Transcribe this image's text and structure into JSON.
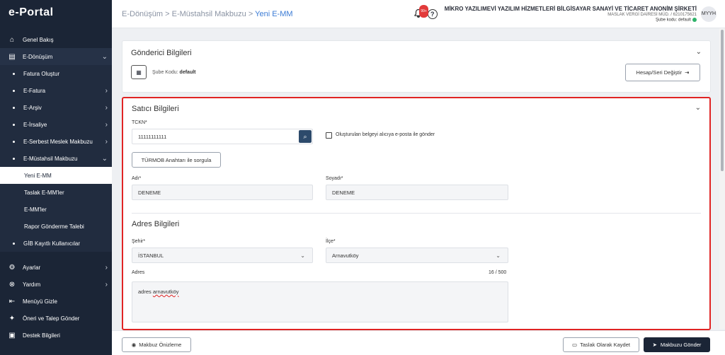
{
  "app": {
    "logo": "e-Portal"
  },
  "sidebar": {
    "items": [
      {
        "label": "Genel Bakış",
        "icon": "home-icon",
        "glyph": "⌂"
      },
      {
        "label": "E-Dönüşüm",
        "icon": "document-icon",
        "glyph": "▤",
        "chevron": "⌄"
      },
      {
        "label": "Fatura Oluştur"
      },
      {
        "label": "E-Fatura",
        "chevron": "›"
      },
      {
        "label": "E-Arşiv",
        "chevron": "›"
      },
      {
        "label": "E-İrsaliye",
        "chevron": "›"
      },
      {
        "label": "E-Serbest Meslek Makbuzu",
        "chevron": "›"
      },
      {
        "label": "E-Müstahsil Makbuzu",
        "chevron": "⌄"
      },
      {
        "label": "Yeni E-MM"
      },
      {
        "label": "Taslak E-MM'ler"
      },
      {
        "label": "E-MM'ler"
      },
      {
        "label": "Rapor Gönderme Talebi"
      },
      {
        "label": "GİB Kayıtlı Kullanıcılar"
      }
    ],
    "bottom": [
      {
        "label": "Ayarlar",
        "icon": "gear-icon",
        "glyph": "⚙",
        "chevron": "›"
      },
      {
        "label": "Yardım",
        "icon": "help-circle-icon",
        "glyph": "⊗",
        "chevron": "›"
      },
      {
        "label": "Menüyü Gizle",
        "icon": "collapse-menu-icon",
        "glyph": "⇤"
      },
      {
        "label": "Öneri ve Talep Gönder",
        "icon": "lightbulb-icon",
        "glyph": "✦"
      },
      {
        "label": "Destek Bilgileri",
        "icon": "support-icon",
        "glyph": "▣"
      }
    ]
  },
  "header": {
    "breadcrumb": {
      "part1": "E-Dönüşüm",
      "sep": " > ",
      "part2": "E-Müstahsil Makbuzu",
      "current": "Yeni E-MM"
    },
    "notification_count": "99+",
    "company_name": "MİKRO YAZILIMEVİ YAZILIM HİZMETLERİ BİLGİSAYAR SANAYİ VE TİCARET ANONİM ŞİRKETİ",
    "tax_office": "MASLAK VERGİ DAİRESİ MÜD. / 6210175621",
    "branch_label": "Şube kodu: default",
    "avatar": "MYYH"
  },
  "sender": {
    "title": "Gönderici Bilgileri",
    "branch_label": "Şube Kodu:",
    "branch_value": "default",
    "change_button": "Hesap/Seri Değiştir"
  },
  "seller": {
    "title": "Satıcı Bilgileri",
    "tckn_label": "TCKN*",
    "tckn_value": "11111111111",
    "email_checkbox_label": "Oluşturulan belgeyi alıcıya e-posta ile gönder",
    "turmob_button": "TÜRMOB Anahtarı ile sorgula",
    "name_label": "Adı*",
    "name_value": "DENEME",
    "surname_label": "Soyadı*",
    "surname_value": "DENEME"
  },
  "address": {
    "title": "Adres Bilgileri",
    "city_label": "Şehir*",
    "city_value": "İSTANBUL",
    "district_label": "İlçe*",
    "district_value": "Arnavutköy",
    "address_label": "Adres",
    "address_counter": "16 / 500",
    "address_text_plain": "adres ",
    "address_text_underlined": "arnavutköy"
  },
  "footer": {
    "preview_button": "Makbuz Önizleme",
    "draft_button": "Taslak Olarak Kaydet",
    "send_button": "Makbuzu Gönder"
  },
  "colors": {
    "sidebar_bg": "#1b2536",
    "accent": "#3a7bd5",
    "highlight_border": "#e02424",
    "success": "#2fb36a"
  }
}
